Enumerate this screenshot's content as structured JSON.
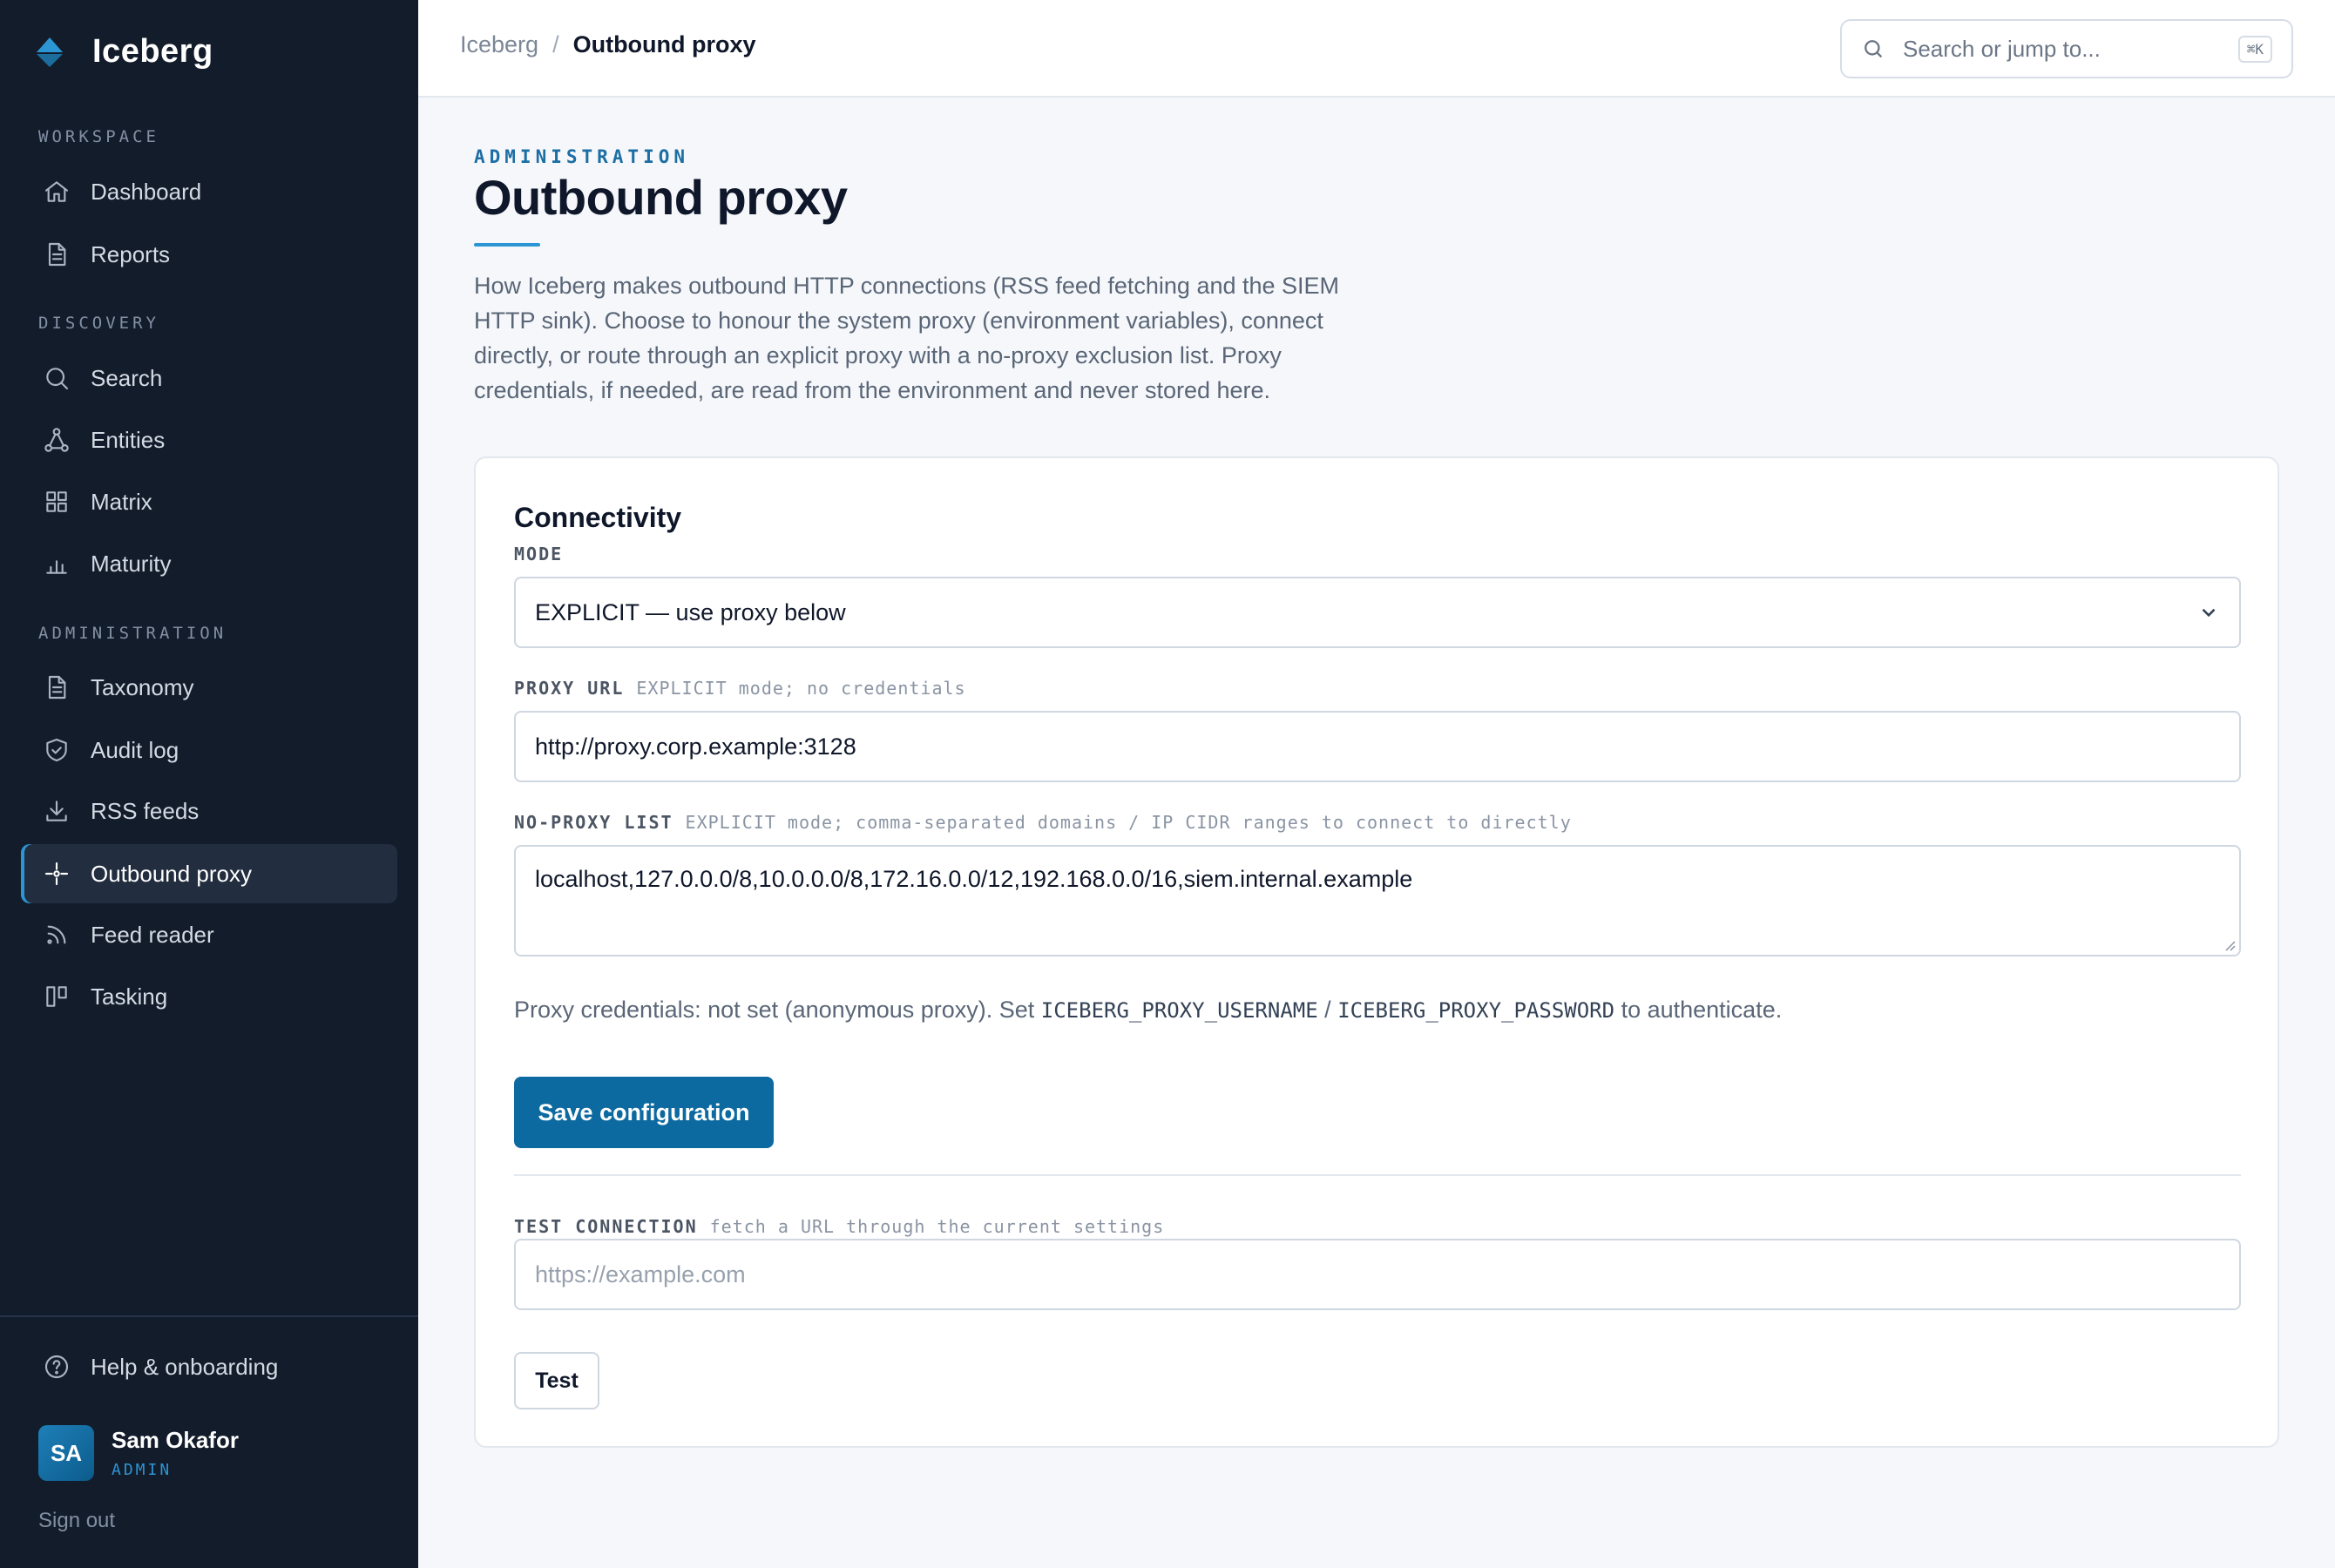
{
  "brand": {
    "name": "Iceberg"
  },
  "sidebar": {
    "sections": [
      {
        "label": "WORKSPACE"
      },
      {
        "label": "DISCOVERY"
      },
      {
        "label": "ADMINISTRATION"
      }
    ],
    "items": [
      {
        "label": "Dashboard",
        "icon": "home-icon"
      },
      {
        "label": "Reports",
        "icon": "document-icon"
      },
      {
        "label": "Search",
        "icon": "search-icon"
      },
      {
        "label": "Entities",
        "icon": "graph-icon"
      },
      {
        "label": "Matrix",
        "icon": "grid-icon"
      },
      {
        "label": "Maturity",
        "icon": "bar-chart-icon"
      },
      {
        "label": "Taxonomy",
        "icon": "document-icon"
      },
      {
        "label": "Audit log",
        "icon": "shield-icon"
      },
      {
        "label": "RSS feeds",
        "icon": "download-icon"
      },
      {
        "label": "Outbound proxy",
        "icon": "crosshair-icon",
        "active": true
      },
      {
        "label": "Feed reader",
        "icon": "rss-icon"
      },
      {
        "label": "Tasking",
        "icon": "kanban-icon"
      }
    ],
    "help_label": "Help & onboarding",
    "user": {
      "initials": "SA",
      "name": "Sam Okafor",
      "role": "ADMIN"
    },
    "signout_label": "Sign out"
  },
  "header": {
    "breadcrumb_root": "Iceberg",
    "breadcrumb_sep": "/",
    "breadcrumb_current": "Outbound proxy",
    "search_placeholder": "Search or jump to...",
    "search_shortcut": "⌘K"
  },
  "page": {
    "eyebrow": "ADMINISTRATION",
    "title": "Outbound proxy",
    "intro": "How Iceberg makes outbound HTTP connections (RSS feed fetching and the SIEM HTTP sink). Choose to honour the system proxy (environment variables), connect directly, or route through an explicit proxy with a no-proxy exclusion list. Proxy credentials, if needed, are read from the environment and never stored here."
  },
  "card": {
    "title": "Connectivity",
    "mode_label": "MODE",
    "mode_value": "EXPLICIT — use proxy below",
    "proxy_url_label": "PROXY URL",
    "proxy_url_hint": "EXPLICIT mode; no credentials",
    "proxy_url_value": "http://proxy.corp.example:3128",
    "no_proxy_label": "NO-PROXY LIST",
    "no_proxy_hint": "EXPLICIT mode; comma-separated domains / IP CIDR ranges to connect to directly",
    "no_proxy_value": "localhost,127.0.0.0/8,10.0.0.0/8,172.16.0.0/12,192.168.0.0/16,siem.internal.example",
    "creds_prefix": "Proxy credentials: not set (anonymous proxy). Set ",
    "creds_user_var": "ICEBERG_PROXY_USERNAME",
    "creds_sep": " / ",
    "creds_pass_var": "ICEBERG_PROXY_PASSWORD",
    "creds_suffix": " to authenticate.",
    "save_label": "Save configuration",
    "test_label": "TEST CONNECTION",
    "test_hint": "fetch a URL through the current settings",
    "test_placeholder": "https://example.com",
    "test_button": "Test"
  },
  "colors": {
    "sidebar_bg": "#131c2b",
    "accent": "#2c95d3",
    "primary_button": "#0c6aa0"
  }
}
